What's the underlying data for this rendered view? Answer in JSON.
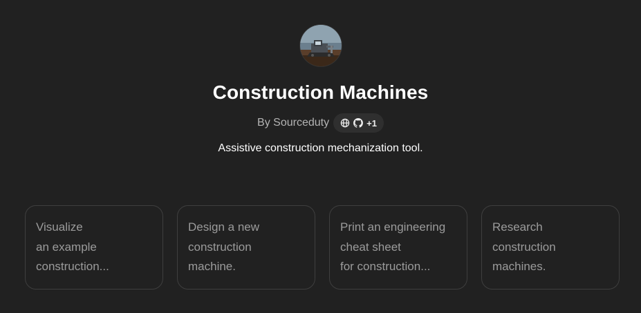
{
  "gpt": {
    "name": "Construction Machines",
    "by_label": "By Sourceduty",
    "badge": {
      "icons": [
        "globe-icon",
        "github-icon"
      ],
      "more": "+1"
    },
    "description": "Assistive construction mechanization tool."
  },
  "starters": [
    {
      "lines": [
        "Visualize",
        "an example",
        "construction..."
      ]
    },
    {
      "lines": [
        "Design a new",
        "construction",
        "machine."
      ]
    },
    {
      "lines": [
        "Print an engineering",
        "cheat sheet",
        "for construction..."
      ]
    },
    {
      "lines": [
        "Research",
        "construction",
        "machines."
      ]
    }
  ],
  "colors": {
    "background": "#212121",
    "card_border": "#3f3f3f",
    "card_text": "#9b9b9b",
    "badge_bg": "#2f2f2f"
  }
}
